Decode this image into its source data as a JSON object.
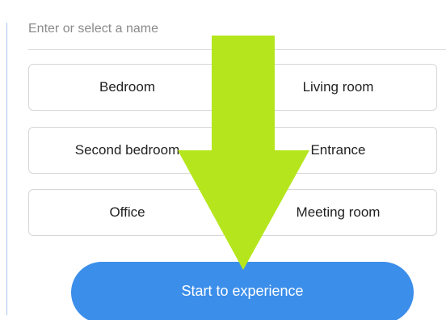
{
  "name_field": {
    "placeholder": "Enter or select a name",
    "value": ""
  },
  "rooms": [
    {
      "label": "Bedroom"
    },
    {
      "label": "Living room"
    },
    {
      "label": "Second bedroom"
    },
    {
      "label": "Entrance"
    },
    {
      "label": "Office"
    },
    {
      "label": "Meeting room"
    }
  ],
  "start_button": {
    "label": "Start to experience"
  },
  "colors": {
    "accent": "#3b8eea",
    "arrow": "#b5e61d",
    "border": "#d6d6d6"
  },
  "annotation": {
    "icon": "down-arrow-icon"
  }
}
